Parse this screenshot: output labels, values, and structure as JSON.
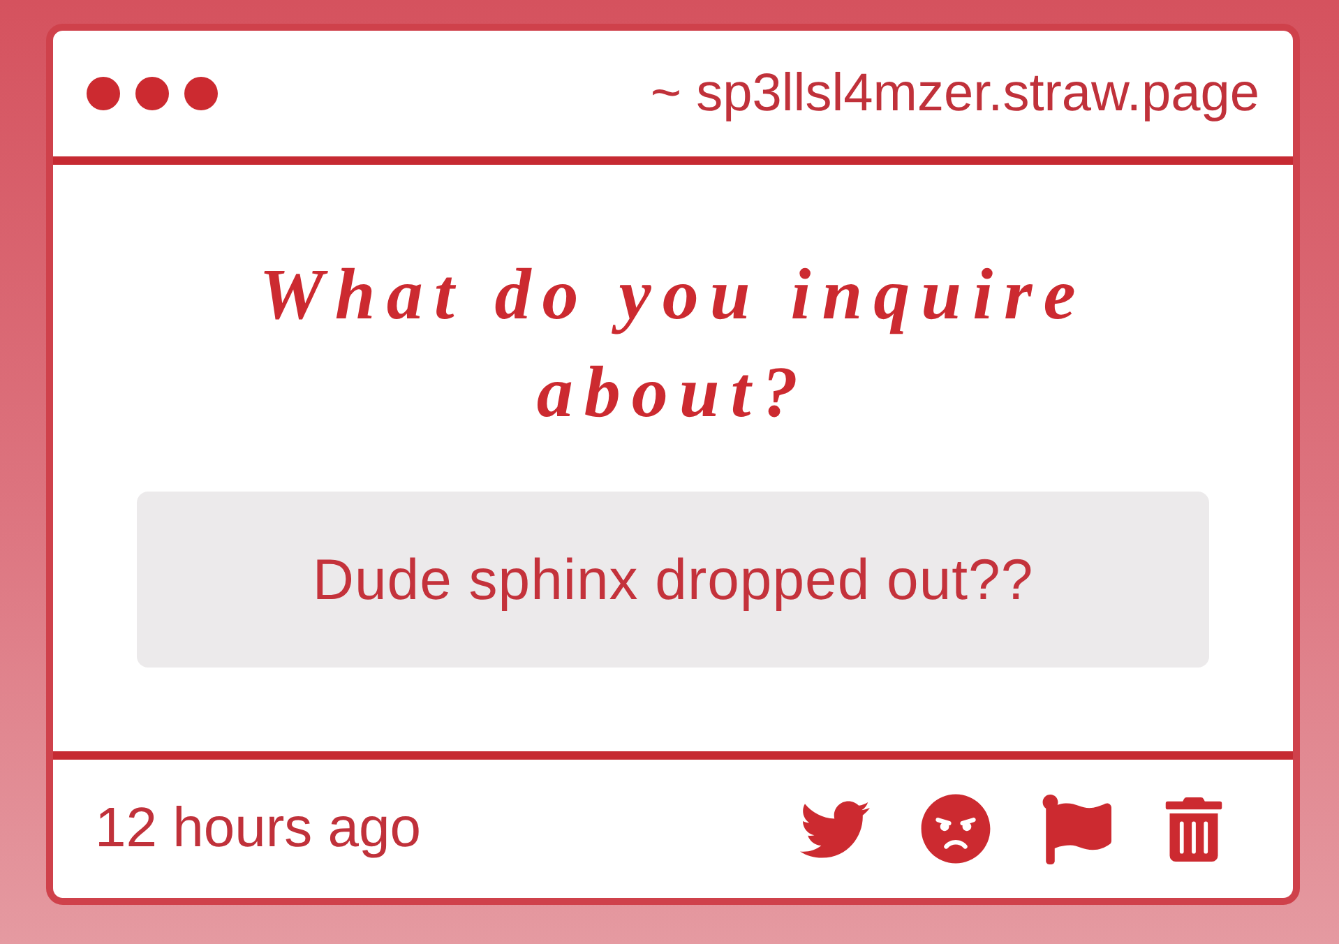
{
  "window": {
    "url": "~ sp3llsl4mzer.straw.page"
  },
  "question": {
    "title": "What do you inquire about?",
    "answer": "Dude sphinx dropped out??"
  },
  "footer": {
    "time": "12 hours ago"
  }
}
